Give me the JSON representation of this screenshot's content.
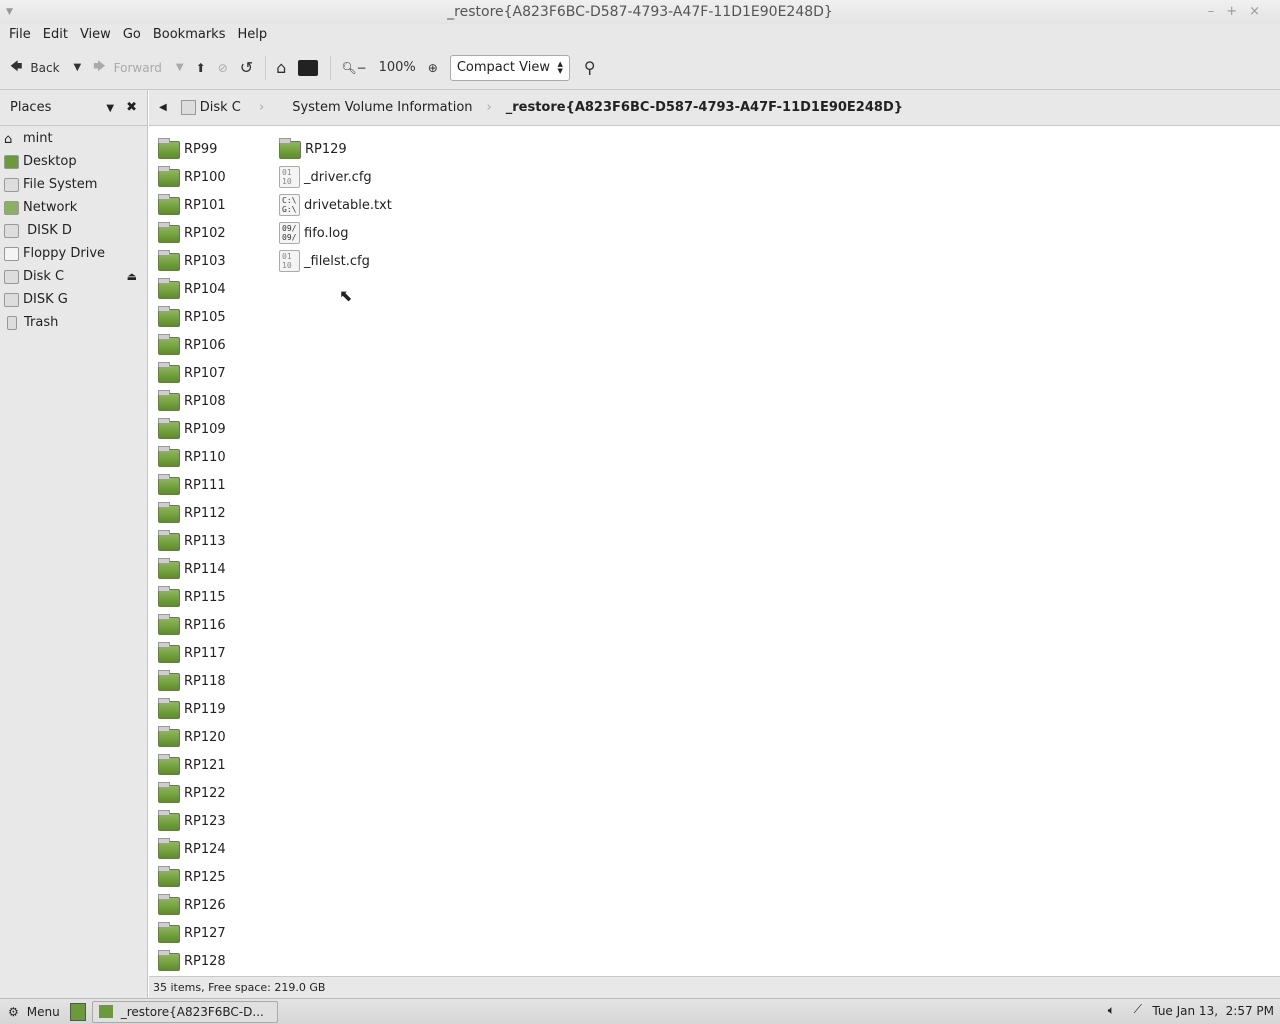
{
  "window": {
    "title": "_restore{A823F6BC-D587-4793-A47F-11D1E90E248D}"
  },
  "menu": [
    "File",
    "Edit",
    "View",
    "Go",
    "Bookmarks",
    "Help"
  ],
  "toolbar": {
    "back": "Back",
    "forward": "Forward",
    "zoom": "100%",
    "view_mode": "Compact View"
  },
  "sidebar": {
    "title": "Places",
    "items": [
      "mint",
      "Desktop",
      "File System",
      "Network",
      " DISK D",
      "Floppy Drive",
      "Disk C",
      "DISK G",
      "Trash"
    ]
  },
  "path": [
    "Disk C",
    "System Volume Information",
    "_restore{A823F6BC-D587-4793-A47F-11D1E90E248D}"
  ],
  "files": {
    "col1": [
      "RP99",
      "RP100",
      "RP101",
      "RP102",
      "RP103",
      "RP104",
      "RP105",
      "RP106",
      "RP107",
      "RP108",
      "RP109",
      "RP110",
      "RP111",
      "RP112",
      "RP113",
      "RP114",
      "RP115",
      "RP116",
      "RP117",
      "RP118",
      "RP119",
      "RP120",
      "RP121",
      "RP122",
      "RP123",
      "RP124",
      "RP125",
      "RP126",
      "RP127",
      "RP128"
    ],
    "col2": [
      {
        "name": "RP129",
        "type": "folder"
      },
      {
        "name": "_driver.cfg",
        "type": "doc",
        "glyph": "01\n10"
      },
      {
        "name": "drivetable.txt",
        "type": "doc",
        "glyph": "C:\\\nG:\\"
      },
      {
        "name": "fifo.log",
        "type": "doc",
        "glyph": "09/\n09/"
      },
      {
        "name": "_filelst.cfg",
        "type": "doc",
        "glyph": "01\n10"
      }
    ]
  },
  "status": "35 items, Free space: 219.0 GB",
  "taskbar": {
    "menu": "Menu",
    "task": "_restore{A823F6BC-D...",
    "clock": "Tue Jan 13,  2:57 PM"
  }
}
